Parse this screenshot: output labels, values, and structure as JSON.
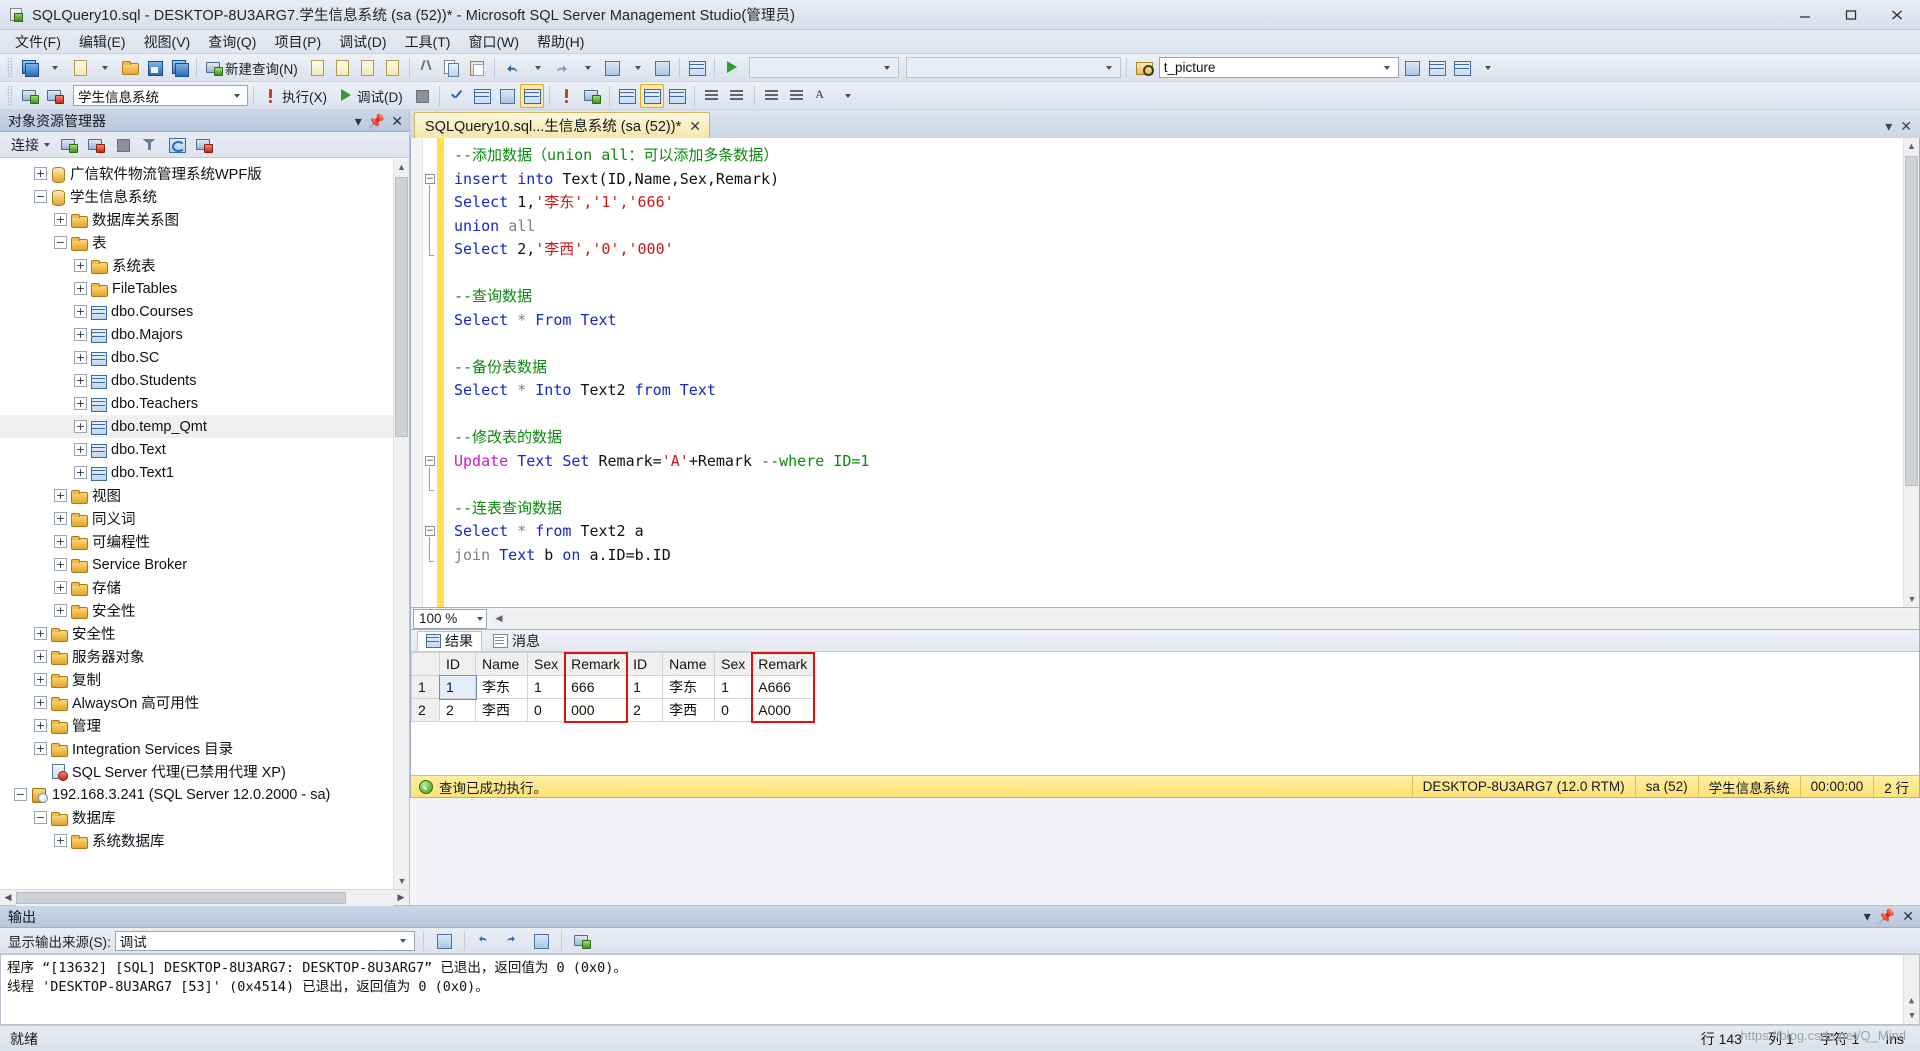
{
  "window": {
    "title": "SQLQuery10.sql - DESKTOP-8U3ARG7.学生信息系统 (sa (52))* - Microsoft SQL Server Management Studio(管理员)",
    "minimize": "—",
    "maximize": "▢",
    "close": "✕"
  },
  "menu": [
    {
      "label": "文件(F)"
    },
    {
      "label": "编辑(E)"
    },
    {
      "label": "视图(V)"
    },
    {
      "label": "查询(Q)"
    },
    {
      "label": "项目(P)"
    },
    {
      "label": "调试(D)"
    },
    {
      "label": "工具(T)"
    },
    {
      "label": "窗口(W)"
    },
    {
      "label": "帮助(H)"
    }
  ],
  "toolbar1": {
    "new_query_label": "新建查询(N)",
    "combo_empty_1": "",
    "combo_empty_2": "",
    "search_value": "t_picture"
  },
  "toolbar2": {
    "database_value": "学生信息系统",
    "execute_label": "执行(X)",
    "debug_label": "调试(D)"
  },
  "object_explorer": {
    "title": "对象资源管理器",
    "connect_label": "连接",
    "tree": [
      {
        "label": "广信软件物流管理系统WPF版",
        "indent": 1,
        "expander": "+",
        "icon": "db"
      },
      {
        "label": "学生信息系统",
        "indent": 1,
        "expander": "−",
        "icon": "db"
      },
      {
        "label": "数据库关系图",
        "indent": 2,
        "expander": "+",
        "icon": "fld"
      },
      {
        "label": "表",
        "indent": 2,
        "expander": "−",
        "icon": "fld"
      },
      {
        "label": "系统表",
        "indent": 3,
        "expander": "+",
        "icon": "fld"
      },
      {
        "label": "FileTables",
        "indent": 3,
        "expander": "+",
        "icon": "fld"
      },
      {
        "label": "dbo.Courses",
        "indent": 3,
        "expander": "+",
        "icon": "tbl"
      },
      {
        "label": "dbo.Majors",
        "indent": 3,
        "expander": "+",
        "icon": "tbl"
      },
      {
        "label": "dbo.SC",
        "indent": 3,
        "expander": "+",
        "icon": "tbl"
      },
      {
        "label": "dbo.Students",
        "indent": 3,
        "expander": "+",
        "icon": "tbl"
      },
      {
        "label": "dbo.Teachers",
        "indent": 3,
        "expander": "+",
        "icon": "tbl"
      },
      {
        "label": "dbo.temp_Qmt",
        "indent": 3,
        "expander": "+",
        "icon": "tbl",
        "highlight": true
      },
      {
        "label": "dbo.Text",
        "indent": 3,
        "expander": "+",
        "icon": "tbl"
      },
      {
        "label": "dbo.Text1",
        "indent": 3,
        "expander": "+",
        "icon": "tbl"
      },
      {
        "label": "视图",
        "indent": 2,
        "expander": "+",
        "icon": "fld"
      },
      {
        "label": "同义词",
        "indent": 2,
        "expander": "+",
        "icon": "fld"
      },
      {
        "label": "可编程性",
        "indent": 2,
        "expander": "+",
        "icon": "fld"
      },
      {
        "label": "Service Broker",
        "indent": 2,
        "expander": "+",
        "icon": "fld"
      },
      {
        "label": "存储",
        "indent": 2,
        "expander": "+",
        "icon": "fld"
      },
      {
        "label": "安全性",
        "indent": 2,
        "expander": "+",
        "icon": "fld"
      },
      {
        "label": "安全性",
        "indent": 1,
        "expander": "+",
        "icon": "fld"
      },
      {
        "label": "服务器对象",
        "indent": 1,
        "expander": "+",
        "icon": "fld"
      },
      {
        "label": "复制",
        "indent": 1,
        "expander": "+",
        "icon": "fld"
      },
      {
        "label": "AlwaysOn 高可用性",
        "indent": 1,
        "expander": "+",
        "icon": "fld"
      },
      {
        "label": "管理",
        "indent": 1,
        "expander": "+",
        "icon": "fld"
      },
      {
        "label": "Integration Services 目录",
        "indent": 1,
        "expander": "+",
        "icon": "fld"
      },
      {
        "label": "SQL Server 代理(已禁用代理 XP)",
        "indent": 1,
        "expander": "",
        "icon": "agent"
      },
      {
        "label": "192.168.3.241 (SQL Server 12.0.2000 - sa)",
        "indent": 0,
        "expander": "−",
        "icon": "srv"
      },
      {
        "label": "数据库",
        "indent": 1,
        "expander": "−",
        "icon": "fld"
      },
      {
        "label": "系统数据库",
        "indent": 2,
        "expander": "+",
        "icon": "fld"
      }
    ]
  },
  "editor": {
    "tab_label": "SQLQuery10.sql...生信息系统 (sa (52))*",
    "tab_close": "✕",
    "zoom_level": "100 %",
    "lines": [
      [
        {
          "t": "--添加数据（union all：可以添加多条数据）",
          "c": "cmt"
        }
      ],
      [
        {
          "t": "insert",
          "c": "kw"
        },
        {
          "t": " ",
          "c": "blk"
        },
        {
          "t": "into",
          "c": "kw"
        },
        {
          "t": " Text(ID,Name,Sex,Remark)",
          "c": "blk"
        }
      ],
      [
        {
          "t": "Select",
          "c": "kw"
        },
        {
          "t": " 1,",
          "c": "blk"
        },
        {
          "t": "'李东','1','666'",
          "c": "str"
        }
      ],
      [
        {
          "t": "union",
          "c": "kw"
        },
        {
          "t": " ",
          "c": "blk"
        },
        {
          "t": "all",
          "c": "gry"
        }
      ],
      [
        {
          "t": "Select",
          "c": "kw"
        },
        {
          "t": " 2,",
          "c": "blk"
        },
        {
          "t": "'李西','0','000'",
          "c": "str"
        }
      ],
      [],
      [
        {
          "t": "--查询数据",
          "c": "cmt"
        }
      ],
      [
        {
          "t": "Select",
          "c": "kw"
        },
        {
          "t": " ",
          "c": "blk"
        },
        {
          "t": "*",
          "c": "gry"
        },
        {
          "t": " ",
          "c": "blk"
        },
        {
          "t": "From",
          "c": "kw"
        },
        {
          "t": " ",
          "c": "blk"
        },
        {
          "t": "Text",
          "c": "kw"
        }
      ],
      [],
      [
        {
          "t": "--备份表数据",
          "c": "cmt"
        }
      ],
      [
        {
          "t": "Select",
          "c": "kw"
        },
        {
          "t": " ",
          "c": "blk"
        },
        {
          "t": "*",
          "c": "gry"
        },
        {
          "t": " ",
          "c": "blk"
        },
        {
          "t": "Into",
          "c": "kw"
        },
        {
          "t": " Text2 ",
          "c": "blk"
        },
        {
          "t": "from",
          "c": "kw"
        },
        {
          "t": " ",
          "c": "blk"
        },
        {
          "t": "Text",
          "c": "kw"
        }
      ],
      [],
      [
        {
          "t": "--修改表的数据",
          "c": "cmt"
        }
      ],
      [
        {
          "t": "Update",
          "c": "kw2"
        },
        {
          "t": " ",
          "c": "blk"
        },
        {
          "t": "Text",
          "c": "kw"
        },
        {
          "t": " ",
          "c": "blk"
        },
        {
          "t": "Set",
          "c": "kw"
        },
        {
          "t": " Remark=",
          "c": "blk"
        },
        {
          "t": "'A'",
          "c": "str"
        },
        {
          "t": "+Remark ",
          "c": "blk"
        },
        {
          "t": "--where ID=1",
          "c": "cmt"
        }
      ],
      [],
      [
        {
          "t": "--连表查询数据",
          "c": "cmt"
        }
      ],
      [
        {
          "t": "Select",
          "c": "kw"
        },
        {
          "t": " ",
          "c": "blk"
        },
        {
          "t": "*",
          "c": "gry"
        },
        {
          "t": " ",
          "c": "blk"
        },
        {
          "t": "from",
          "c": "kw"
        },
        {
          "t": " Text2 a",
          "c": "blk"
        }
      ],
      [
        {
          "t": "join",
          "c": "gry"
        },
        {
          "t": " ",
          "c": "blk"
        },
        {
          "t": "Text",
          "c": "kw"
        },
        {
          "t": " b ",
          "c": "blk"
        },
        {
          "t": "on",
          "c": "kw"
        },
        {
          "t": " a.ID=b.ID",
          "c": "blk"
        }
      ]
    ]
  },
  "results": {
    "tabs": [
      {
        "label": "结果",
        "icon": "grid-icon",
        "active": true
      },
      {
        "label": "消息",
        "icon": "message-icon",
        "active": false
      }
    ],
    "columns": [
      "",
      "ID",
      "Name",
      "Sex",
      "Remark",
      "ID",
      "Name",
      "Sex",
      "Remark"
    ],
    "rows": [
      [
        "1",
        "1",
        "李东",
        "1",
        "666",
        "1",
        "李东",
        "1",
        "A666"
      ],
      [
        "2",
        "2",
        "李西",
        "0",
        "000",
        "2",
        "李西",
        "0",
        "A000"
      ]
    ],
    "status": {
      "message": "查询已成功执行。",
      "server": "DESKTOP-8U3ARG7 (12.0 RTM)",
      "user": "sa (52)",
      "database": "学生信息系统",
      "time": "00:00:00",
      "rowcount": "2 行"
    }
  },
  "output": {
    "title": "输出",
    "source_label": "显示输出来源(S):",
    "source_value": "调试",
    "lines": [
      "线程 'DESKTOP-8U3ARG7 [53]' (0x4514) 已退出，返回值为 0 (0x0)。",
      "程序 “[13632] [SQL] DESKTOP-8U3ARG7: DESKTOP-8U3ARG7” 已退出，返回值为 0 (0x0)。"
    ]
  },
  "statusbar": {
    "ready": "就绪",
    "line_label": "行 143",
    "col_label": "列 1",
    "ins_label": "字符 1",
    "mode": "Ins"
  },
  "watermark": {
    "text": "https://blog.csdn.net/Q_Mind"
  },
  "colors": {
    "accent_yellow": "#ffe14c",
    "tab_active": "#f7e7a8",
    "status_ok": "#ffe278",
    "comment_green": "#0a8a0a",
    "keyword_blue": "#1427c8",
    "string_red": "#d01717",
    "highlight_red": "#e10f0f"
  }
}
